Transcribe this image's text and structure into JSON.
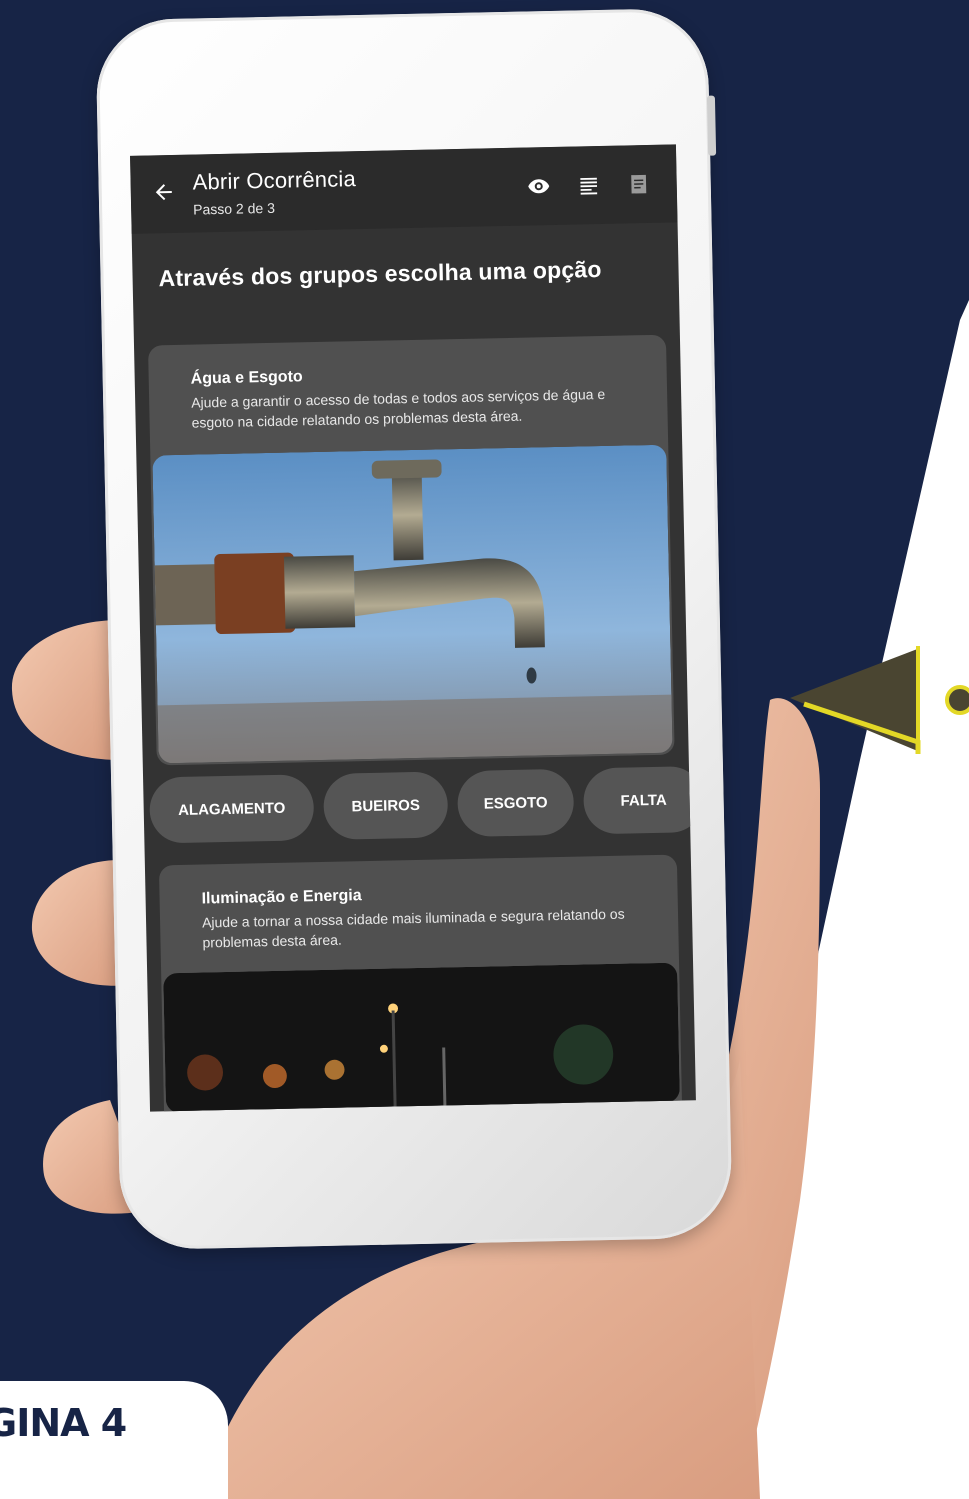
{
  "appbar": {
    "title": "Abrir Ocorrência",
    "subtitle": "Passo 2 de 3",
    "icons": [
      "back-arrow-icon",
      "eye-icon",
      "list-icon",
      "document-icon"
    ]
  },
  "heading": "Através dos grupos escolha uma opção",
  "groups": [
    {
      "title": "Água e Esgoto",
      "description": "Ajude a garantir o acesso de todas e todos aos serviços de água e esgoto na cidade relatando os problemas desta área.",
      "image": "water-faucet-photo",
      "chips": [
        "ALAGAMENTO",
        "BUEIROS",
        "ESGOTO",
        "FALTA"
      ]
    },
    {
      "title": "Iluminação e Energia",
      "description": "Ajude a tornar a nossa cidade mais iluminada e segura relatando os problemas desta área.",
      "image": "street-lights-night-photo"
    }
  ],
  "page_label": "GINA 4",
  "colors": {
    "background": "#172446",
    "accent": "#E3D826",
    "pointer": "#4A4531",
    "screen": "#333333",
    "card": "#505050"
  }
}
